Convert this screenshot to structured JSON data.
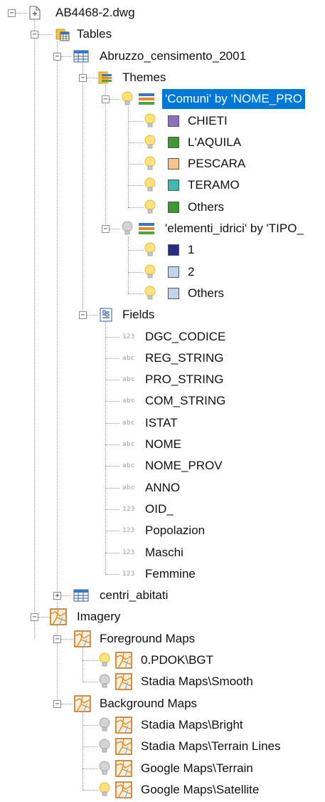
{
  "tree": {
    "root": "AB4468-2.dwg",
    "tables": "Tables",
    "table1": "Abruzzo_censimento_2001",
    "themes": "Themes",
    "theme1": "'Comuni' by 'NOME_PRO",
    "theme1_items": [
      {
        "label": "CHIETI",
        "color": "#8e6fbe"
      },
      {
        "label": "L'AQUILA",
        "color": "#3c9a2e"
      },
      {
        "label": "PESCARA",
        "color": "#f4c48a"
      },
      {
        "label": "TERAMO",
        "color": "#3fb8b0"
      },
      {
        "label": "Others",
        "color": "#3c9a2e"
      }
    ],
    "theme2": "'elementi_idrici' by 'TIPO_",
    "theme2_items": [
      {
        "label": "1",
        "color": "#2a2a8a"
      },
      {
        "label": "2",
        "color": "#c3d3ea"
      },
      {
        "label": "Others",
        "color": "#c3d3ea"
      }
    ],
    "fields_label": "Fields",
    "fields": [
      {
        "type": "123",
        "name": "DGC_CODICE"
      },
      {
        "type": "abc",
        "name": "REG_STRING"
      },
      {
        "type": "abc",
        "name": "PRO_STRING"
      },
      {
        "type": "abc",
        "name": "COM_STRING"
      },
      {
        "type": "abc",
        "name": "ISTAT"
      },
      {
        "type": "abc",
        "name": "NOME"
      },
      {
        "type": "abc",
        "name": "NOME_PROV"
      },
      {
        "type": "abc",
        "name": "ANNO"
      },
      {
        "type": "123",
        "name": "OID_"
      },
      {
        "type": "123",
        "name": "Popolazion"
      },
      {
        "type": "123",
        "name": "Maschi"
      },
      {
        "type": "123",
        "name": "Femmine"
      }
    ],
    "table2": "centri_abitati",
    "imagery": "Imagery",
    "foreground": "Foreground Maps",
    "foreground_items": [
      {
        "label": "0.PDOK\\BGT",
        "visible": true
      },
      {
        "label": "Stadia Maps\\Smooth",
        "visible": false
      }
    ],
    "background": "Background Maps",
    "background_items": [
      {
        "label": "Stadia Maps\\Bright",
        "visible": false
      },
      {
        "label": "Stadia Maps\\Terrain Lines",
        "visible": false
      },
      {
        "label": "Google Maps\\Terrain",
        "visible": false
      },
      {
        "label": "Google Maps\\Satellite",
        "visible": true
      }
    ]
  }
}
